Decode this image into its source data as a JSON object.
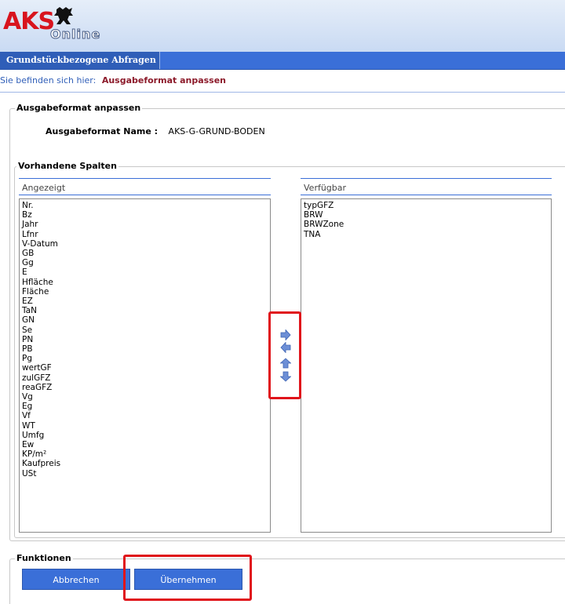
{
  "header": {
    "logo_main": "AKS",
    "logo_sub": "Online"
  },
  "nav": {
    "tab_label": "Grundstückbezogene Abfragen"
  },
  "breadcrumb": {
    "prefix": "Sie befinden sich hier:",
    "current": "Ausgabeformat anpassen"
  },
  "section_format": {
    "legend": "Ausgabeformat anpassen",
    "name_label": "Ausgabeformat Name :",
    "name_value": "AKS-G-GRUND-BODEN"
  },
  "section_columns": {
    "legend": "Vorhandene Spalten",
    "shown_header": "Angezeigt",
    "available_header": "Verfügbar",
    "shown_items": [
      "Nr.",
      "Bz",
      "Jahr",
      "Lfnr",
      "V-Datum",
      "GB",
      "Gg",
      "E",
      "Hfläche",
      "Fläche",
      "EZ",
      "TaN",
      "GN",
      "Se",
      "PN",
      "PB",
      "Pg",
      "wertGF",
      "zulGFZ",
      "reaGFZ",
      "Vg",
      "Eg",
      "Vf",
      "WT",
      "Umfg",
      "Ew",
      "KP/m²",
      "Kaufpreis",
      "USt"
    ],
    "available_items": [
      "typGFZ",
      "BRW",
      "BRWZone",
      "TNA"
    ]
  },
  "arrows": {
    "right_icon": "arrow-right-icon",
    "left_icon": "arrow-left-icon",
    "up_icon": "arrow-up-icon",
    "down_icon": "arrow-down-icon"
  },
  "section_functions": {
    "legend": "Funktionen",
    "cancel_label": "Abbrechen",
    "apply_label": "Übernehmen"
  },
  "colors": {
    "brand_red": "#d8141e",
    "nav_blue": "#3a6fd8",
    "highlight_red": "#e0141b",
    "breadcrumb_current": "#8c1a2a"
  }
}
